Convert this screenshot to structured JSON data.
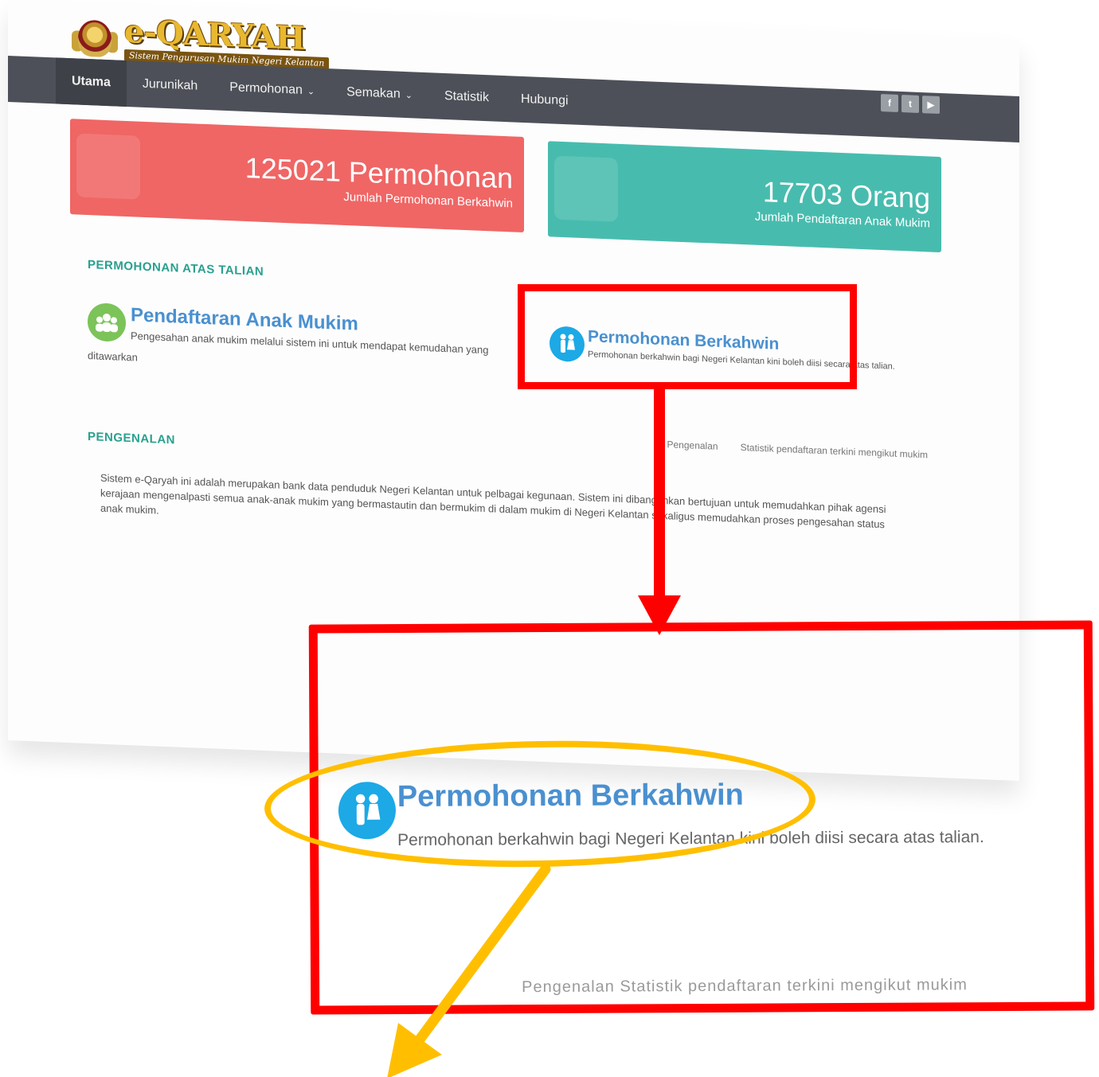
{
  "logo": {
    "title": "e-QARYAH",
    "subtitle": "Sistem Pengurusan Mukim Negeri Kelantan"
  },
  "nav": {
    "items": [
      {
        "label": "Utama",
        "active": true
      },
      {
        "label": "Jurunikah",
        "dropdown": false
      },
      {
        "label": "Permohonan",
        "dropdown": true
      },
      {
        "label": "Semakan",
        "dropdown": true
      },
      {
        "label": "Statistik",
        "dropdown": false
      },
      {
        "label": "Hubungi",
        "dropdown": false
      }
    ],
    "social": [
      "facebook-icon",
      "twitter-icon",
      "youtube-icon"
    ]
  },
  "stats": {
    "applications": {
      "value": "125021 Permohonan",
      "label": "Jumlah Permohonan Berkahwin",
      "color": "#ef6665"
    },
    "residents": {
      "value": "17703 Orang",
      "label": "Jumlah Pendaftaran Anak Mukim",
      "color": "#47bcae"
    }
  },
  "online": {
    "title": "PERMOHONAN ATAS TALIAN",
    "items": [
      {
        "title": "Pendaftaran Anak Mukim",
        "desc": "Pengesahan anak mukim melalui sistem ini untuk mendapat kemudahan yang",
        "desc_wrap": "ditawarkan"
      },
      {
        "title": "Permohonan Berkahwin",
        "desc": "Permohonan berkahwin bagi Negeri Kelantan kini boleh diisi secara atas talian."
      }
    ]
  },
  "intro": {
    "title": "PENGENALAN",
    "tabs": [
      "Pengenalan",
      "Statistik pendaftaran terkini mengikut mukim"
    ],
    "text": "Sistem e-Qaryah ini adalah merupakan bank data penduduk Negeri Kelantan untuk pelbagai kegunaan. Sistem ini dibangunkan bertujuan untuk memudahkan pihak agensi kerajaan mengenalpasti semua anak-anak mukim yang bermastautin dan bermukim di dalam mukim di Negeri Kelantan sekaligus memudahkan proses pengesahan status anak mukim."
  },
  "zoom": {
    "title": "Permohonan Berkahwin",
    "desc": "Permohonan berkahwin bagi Negeri Kelantan kini boleh diisi secara atas talian.",
    "bottom": "Pengenalan    Statistik pendaftaran terkini mengikut mukim"
  },
  "annotations": {
    "box_color": "#ff0000",
    "ellipse_color": "#ffbf00"
  }
}
